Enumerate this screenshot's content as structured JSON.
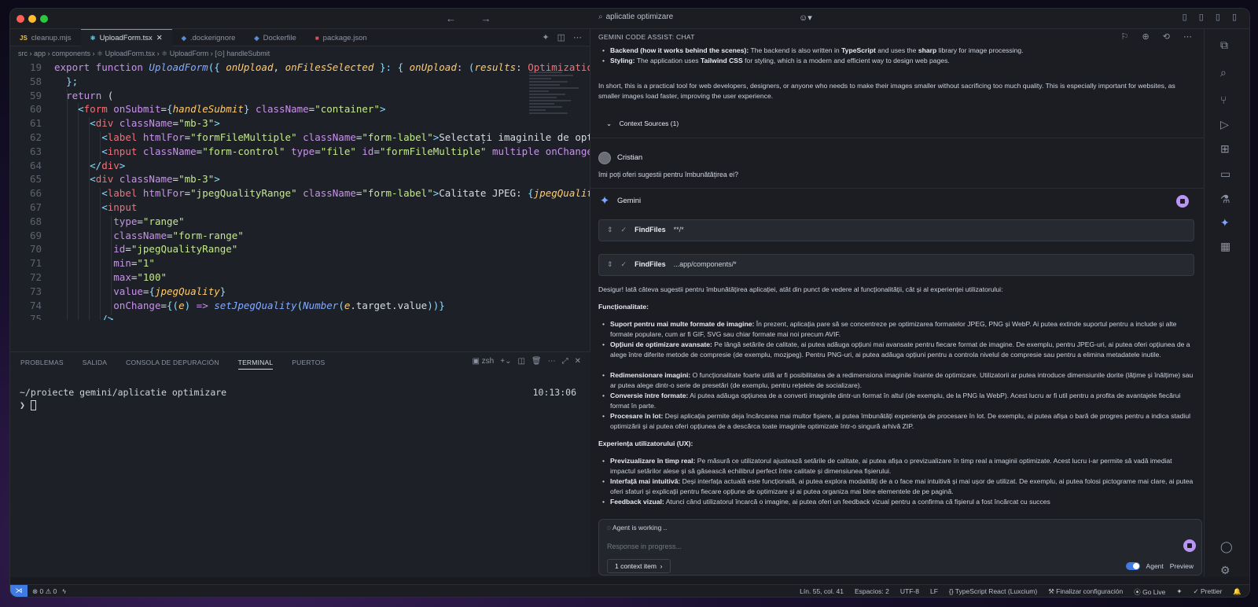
{
  "window": {
    "search_text": "aplicatie optimizare",
    "tb_right_icons": "▯ ▯ ▯ ▯"
  },
  "editor": {
    "tabs": [
      {
        "icon": "JS",
        "label": "cleanup.mjs",
        "color": "#e8c14a"
      },
      {
        "icon": "⚛",
        "label": "UploadForm.tsx",
        "color": "#61dafb",
        "active": true
      },
      {
        "icon": "◆",
        "label": ".dockerignore",
        "color": "#5b8bd6"
      },
      {
        "icon": "◆",
        "label": "Dockerfile",
        "color": "#5b8bd6"
      },
      {
        "icon": "■",
        "label": "package.json",
        "color": "#e0525a"
      }
    ],
    "breadcrumb": "src › app › components › ⚛ UploadForm.tsx › ⚛ UploadForm › [⊙] handleSubmit",
    "line_numbers": [
      "19",
      "58",
      "59",
      "60",
      "61",
      "62",
      "63",
      "64",
      "65",
      "66",
      "67",
      "68",
      "69",
      "70",
      "71",
      "72",
      "73",
      "74",
      "75"
    ]
  },
  "panel": {
    "tabs": [
      "PROBLEMAS",
      "SALIDA",
      "CONSOLA DE DEPURACIÓN",
      "TERMINAL",
      "PUERTOS"
    ],
    "active_tab": "TERMINAL",
    "shell": "zsh",
    "cwd": "~/proiecte gemini/aplicatie optimizare",
    "time": "10:13:06",
    "prompt": "❯"
  },
  "chat": {
    "header": "GEMINI CODE ASSIST: CHAT",
    "backend_label": "Backend (how it works behind the scenes):",
    "backend_text_a": " The backend is also written in ",
    "backend_ts": "TypeScript",
    "backend_text_b": " and uses the ",
    "backend_sharp": "sharp",
    "backend_text_c": " library for image processing.",
    "styling_label": "Styling:",
    "styling_text_a": " The application uses ",
    "styling_tw": "Tailwind CSS",
    "styling_text_b": " for styling, which is a modern and efficient way to design web pages.",
    "summary": "In short, this is a practical tool for web developers, designers, or anyone who needs to make their images smaller without sacrificing too much quality. This is especially important for websites, as smaller images load faster, improving the user experience.",
    "context_sources": "Context Sources (1)",
    "user_name": "Cristian",
    "user_message": "îmi poți oferi sugestii pentru îmbunătățirea ei?",
    "assistant_name": "Gemini",
    "tool1_name": "FindFiles",
    "tool1_arg": "**/*",
    "tool2_name": "FindFiles",
    "tool2_arg": "...app/components/*",
    "intro": "Desigur! Iată câteva sugestii pentru îmbunătățirea aplicației, atât din punct de vedere al funcționalității, cât și al experienței utilizatorului:",
    "section1": "Funcționalitate:",
    "f1_label": "Suport pentru mai multe formate de imagine:",
    "f1_text": " În prezent, aplicația pare să se concentreze pe optimizarea formatelor JPEG, PNG și WebP. Ai putea extinde suportul pentru a include și alte formate populare, cum ar fi GIF, SVG sau chiar formate mai noi precum AVIF.",
    "f2_label": "Opțiuni de optimizare avansate:",
    "f2_text": " Pe lângă setările de calitate, ai putea adăuga opțiuni mai avansate pentru fiecare format de imagine. De exemplu, pentru JPEG-uri, ai putea oferi opțiunea de a alege între diferite metode de compresie (de exemplu, mozjpeg). Pentru PNG-uri, ai putea adăuga opțiuni pentru a controla nivelul de compresie sau pentru a elimina metadatele inutile.",
    "f3_label": "Redimensionare imagini:",
    "f3_text": " O funcționalitate foarte utilă ar fi posibilitatea de a redimensiona imaginile înainte de optimizare. Utilizatorii ar putea introduce dimensiunile dorite (lățime și înălțime) sau ar putea alege dintr-o serie de presetări (de exemplu, pentru rețelele de socializare).",
    "f4_label": "Conversie între formate:",
    "f4_text": " Ai putea adăuga opțiunea de a converti imaginile dintr-un format în altul (de exemplu, de la PNG la WebP). Acest lucru ar fi util pentru a profita de avantajele fiecărui format în parte.",
    "f5_label": "Procesare în lot:",
    "f5_text": " Deși aplicația permite deja încărcarea mai multor fișiere, ai putea îmbunătăți experiența de procesare în lot. De exemplu, ai putea afișa o bară de progres pentru a indica stadiul optimizării și ai putea oferi opțiunea de a descărca toate imaginile optimizate într-o singură arhivă ZIP.",
    "section2": "Experiența utilizatorului (UX):",
    "u1_label": "Previzualizare în timp real:",
    "u1_text": " Pe măsură ce utilizatorul ajustează setările de calitate, ai putea afișa o previzualizare în timp real a imaginii optimizate. Acest lucru i-ar permite să vadă imediat impactul setărilor alese și să găsească echilibrul perfect între calitate și dimensiunea fișierului.",
    "u2_label": "Interfață mai intuitivă:",
    "u2_text": " Deși interfața actuală este funcțională, ai putea explora modalități de a o face mai intuitivă și mai ușor de utilizat. De exemplu, ai putea folosi pictograme mai clare, ai putea oferi sfaturi și explicații pentru fiecare opțiune de optimizare și ai putea organiza mai bine elementele de pe pagină.",
    "u3_label": "Feedback vizual:",
    "u3_text": " Atunci când utilizatorul încarcă o imagine, ai putea oferi un feedback vizual pentru a confirma că fișierul a fost încărcat cu succes",
    "agent_status": "Agent is working  ..",
    "input_placeholder": "Response in progress...",
    "context_chip": "1 context item",
    "agent_label": "Agent",
    "preview_label": "Preview"
  },
  "status": {
    "problems": "⊗ 0 ⚠ 0",
    "position": "Lín. 55, col. 41",
    "spaces": "Espacios: 2",
    "encoding": "UTF-8",
    "eol": "LF",
    "language": "{} TypeScript React (Luxcium)",
    "config": "Finalizar configuración",
    "golive": "Go Live",
    "prettier": "✓ Prettier"
  },
  "colors": {
    "accent": "#3f7be0",
    "stop": "#b894f5",
    "gemini": "#7ea6ff"
  }
}
